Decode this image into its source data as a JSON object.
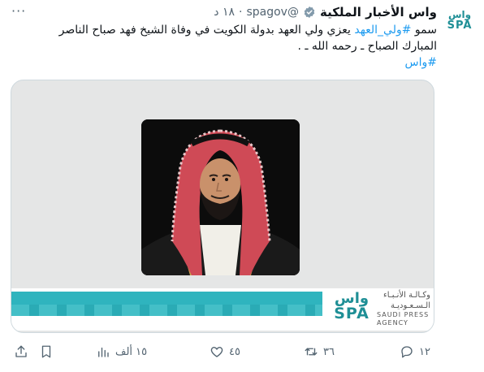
{
  "tweet": {
    "avatar": {
      "line1": "واس",
      "line2": "SPA"
    },
    "display_name": "واس الأخبار الملكية",
    "handle": "@spagov",
    "separator": "·",
    "time": "١٨ د",
    "more": "···",
    "text_before_tag": "سمو ",
    "hashtag_1": "#ولي_العهد",
    "text_after_tag": " يعزي ولي العهد بدولة الكويت في وفاة الشيخ فهد صباح الناصر",
    "text_line2": "المبارك الصباح ـ رحمه الله ـ .",
    "hashtag_2": "#واس"
  },
  "media": {
    "logo_mark_top": "واس",
    "logo_mark_bottom": "SPA",
    "logo_ar_line1": "وكـالـة الأنـبـاء",
    "logo_ar_line2": "الـسـعـوديـة",
    "logo_en_line1": "SAUDI PRESS",
    "logo_en_line2": "AGENCY",
    "accent_color": "#2fb4be"
  },
  "actions": {
    "replies": "١٢",
    "retweets": "٣٦",
    "likes": "٤٥",
    "views": "١٥ ألف"
  }
}
